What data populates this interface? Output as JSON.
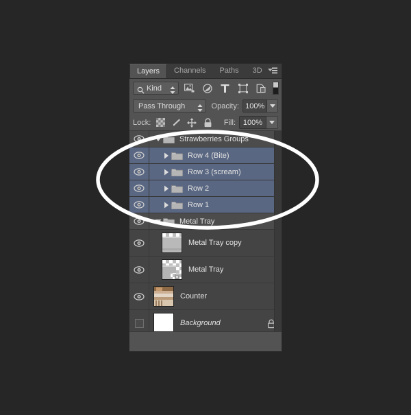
{
  "panel": {
    "tabs": [
      {
        "label": "Layers",
        "active": true
      },
      {
        "label": "Channels",
        "active": false
      },
      {
        "label": "Paths",
        "active": false
      },
      {
        "label": "3D",
        "active": false
      }
    ],
    "menu_icon": "panel-menu-icon"
  },
  "filter": {
    "kind_label": "Kind",
    "search_icon": "search-icon",
    "type_icons": [
      {
        "name": "pixel-layer-filter-icon"
      },
      {
        "name": "adjustment-layer-filter-icon"
      },
      {
        "name": "type-layer-filter-icon"
      },
      {
        "name": "shape-layer-filter-icon"
      },
      {
        "name": "smart-object-filter-icon"
      }
    ],
    "toggle_name": "filter-enable-toggle"
  },
  "options": {
    "blend_mode": "Pass Through",
    "opacity_caption": "Opacity:",
    "opacity_value": "100%",
    "fill_caption": "Fill:",
    "fill_value": "100%",
    "lock_caption": "Lock:",
    "lock_icons": [
      {
        "name": "lock-transparent-pixels-icon"
      },
      {
        "name": "lock-image-pixels-icon"
      },
      {
        "name": "lock-position-icon"
      },
      {
        "name": "lock-all-icon"
      }
    ]
  },
  "layers": [
    {
      "name": "Strawberries Groups",
      "type": "group",
      "visible": true,
      "selected": false,
      "expanded": true,
      "indent": 0,
      "locked": false
    },
    {
      "name": "Row 4 (Bite)",
      "type": "group",
      "visible": true,
      "selected": true,
      "expanded": false,
      "indent": 1,
      "locked": false
    },
    {
      "name": "Row 3 (scream)",
      "type": "group",
      "visible": true,
      "selected": true,
      "expanded": false,
      "indent": 1,
      "locked": false
    },
    {
      "name": "Row 2",
      "type": "group",
      "visible": true,
      "selected": true,
      "expanded": false,
      "indent": 1,
      "locked": false
    },
    {
      "name": "Row 1",
      "type": "group",
      "visible": true,
      "selected": true,
      "expanded": false,
      "indent": 1,
      "locked": false
    },
    {
      "name": "Metal Tray",
      "type": "group",
      "visible": true,
      "selected": false,
      "expanded": true,
      "indent": 0,
      "locked": false
    },
    {
      "name": "Metal Tray copy",
      "type": "layer",
      "thumb": "metal-tray-copy",
      "visible": true,
      "selected": false,
      "indent": 1,
      "locked": false
    },
    {
      "name": "Metal Tray",
      "type": "layer",
      "thumb": "metal-tray",
      "visible": true,
      "selected": false,
      "indent": 1,
      "locked": false
    },
    {
      "name": "Counter",
      "type": "layer",
      "thumb": "counter",
      "visible": true,
      "selected": false,
      "indent": 0,
      "locked": false
    },
    {
      "name": "Background",
      "type": "layer",
      "thumb": "white",
      "visible": false,
      "selected": false,
      "indent": 0,
      "locked": true,
      "italic": true
    }
  ],
  "annotation": {
    "shape": "ellipse-highlight",
    "color": "#ffffff"
  },
  "colors": {
    "background": "#262626",
    "panel": "#535353",
    "list": "#444444",
    "selected_row": "#5a6782",
    "group_header": "#4c4c4c",
    "text": "#e3e3e3",
    "annotation": "#ffffff"
  }
}
